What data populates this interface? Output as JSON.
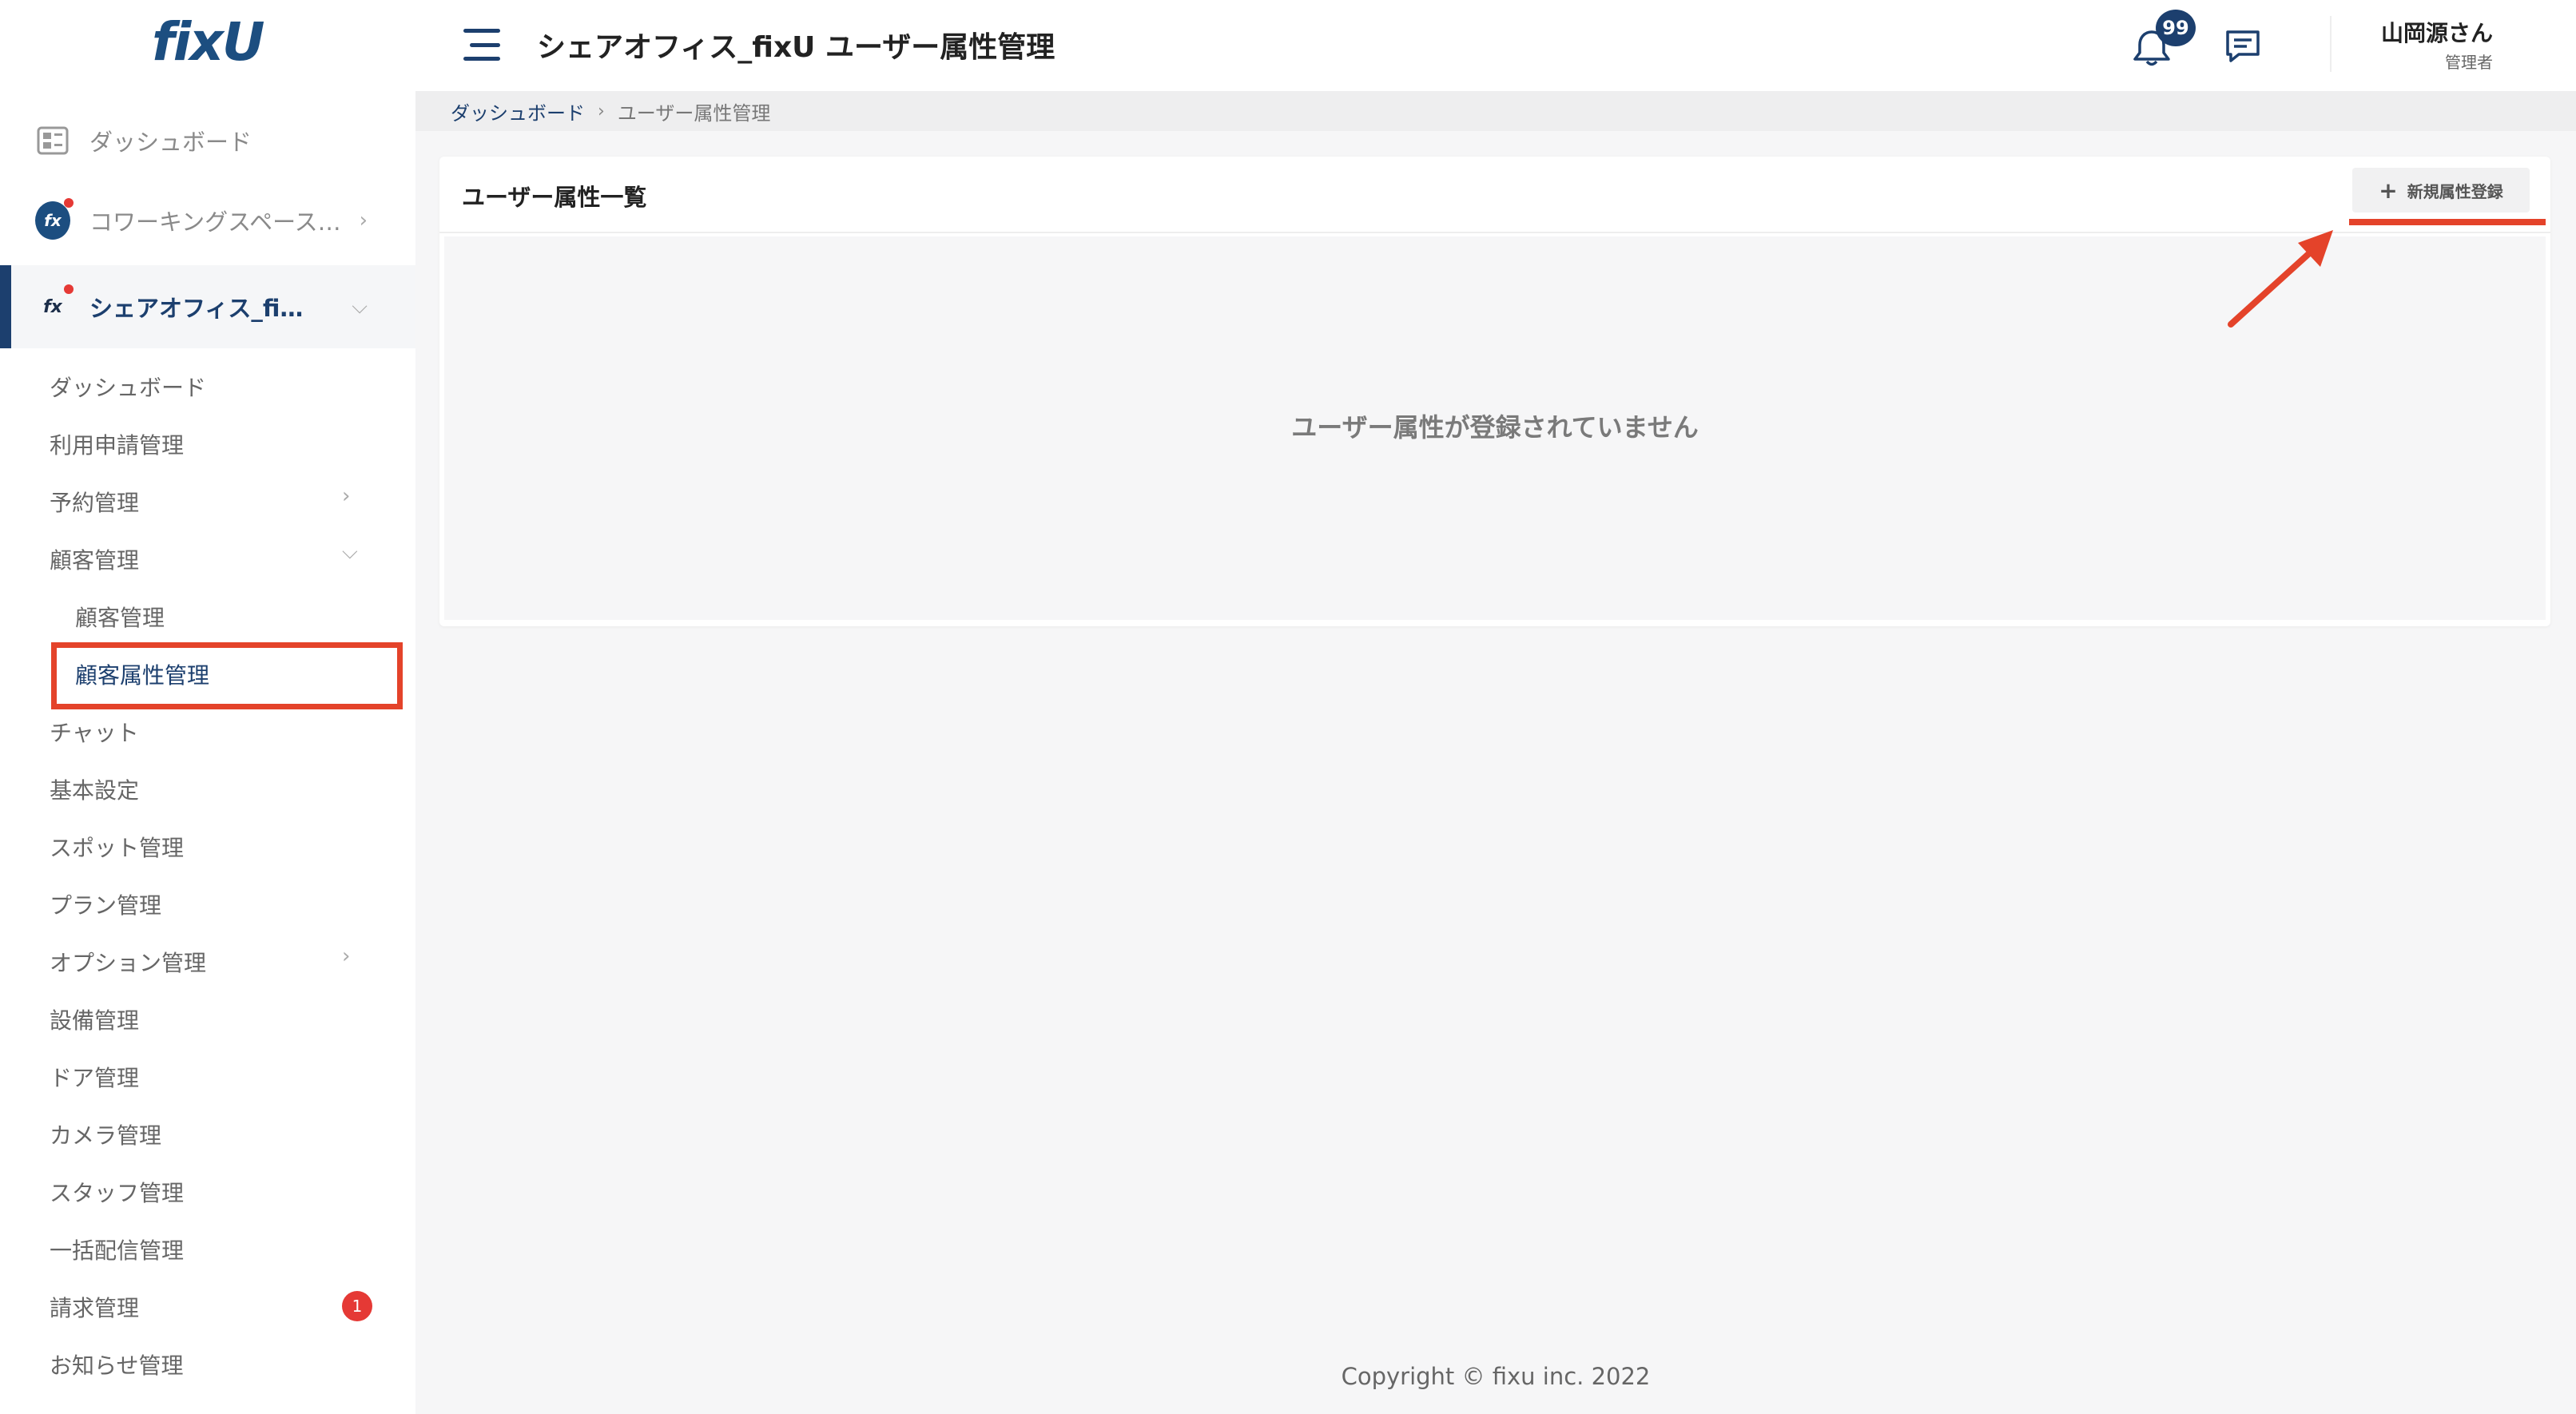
{
  "brand": {
    "logo_text": "fixU"
  },
  "sidebar": {
    "top_items": [
      {
        "label": "ダッシュボード",
        "icon": "dashboard-icon"
      },
      {
        "label": "コワーキングスペース…",
        "icon": "fixu-icon"
      },
      {
        "label": "シェアオフィス_fi…",
        "icon": "fixu-icon",
        "active": true
      }
    ],
    "sub_items": [
      {
        "label": "ダッシュボード"
      },
      {
        "label": "利用申請管理"
      },
      {
        "label": "予約管理",
        "chevron": "right"
      },
      {
        "label": "顧客管理",
        "chevron": "down"
      },
      {
        "label": "顧客管理",
        "level": 2
      },
      {
        "label": "顧客属性管理",
        "level": 2,
        "selected": true
      },
      {
        "label": "チャット"
      },
      {
        "label": "基本設定"
      },
      {
        "label": "スポット管理"
      },
      {
        "label": "プラン管理"
      },
      {
        "label": "オプション管理",
        "chevron": "right"
      },
      {
        "label": "設備管理"
      },
      {
        "label": "ドア管理"
      },
      {
        "label": "カメラ管理"
      },
      {
        "label": "スタッフ管理"
      },
      {
        "label": "一括配信管理"
      },
      {
        "label": "請求管理",
        "badge": "1"
      },
      {
        "label": "お知らせ管理"
      }
    ]
  },
  "header": {
    "title": "シェアオフィス_fixU ユーザー属性管理",
    "notification_count": "99",
    "user_name": "山岡源さん",
    "user_role": "管理者"
  },
  "breadcrumb": {
    "home": "ダッシュボード",
    "current": "ユーザー属性管理"
  },
  "card": {
    "title": "ユーザー属性一覧",
    "new_button_label": "新規属性登録",
    "empty_message": "ユーザー属性が登録されていません"
  },
  "footer": {
    "copyright": "Copyright © fixu inc. 2022"
  },
  "colors": {
    "brand_navy": "#1c3f6e",
    "annotation_red": "#e4432a",
    "badge_red": "#e53935"
  }
}
